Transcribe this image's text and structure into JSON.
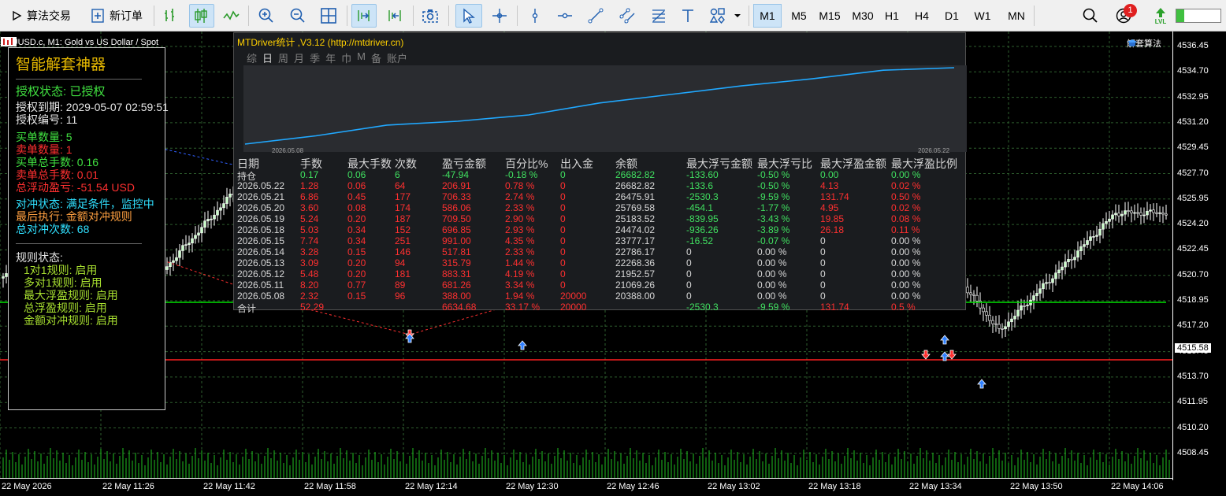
{
  "toolbar": {
    "algo_trading_label": "算法交易",
    "new_order_label": "新订单",
    "timeframes": [
      "M1",
      "M5",
      "M15",
      "M30",
      "H1",
      "H4",
      "D1",
      "W1",
      "MN"
    ],
    "active_timeframe": "M1",
    "notification_count": "1",
    "lvl_label": "LVL"
  },
  "chart": {
    "symbol_label": "XAUUSD.c, M1:  Gold vs US Dollar / Spot",
    "algo_name": "解套算法",
    "current_price": "4515.58",
    "price_ticks": [
      "4536.45",
      "4534.70",
      "4532.95",
      "4531.20",
      "4529.45",
      "4527.70",
      "4525.95",
      "4524.20",
      "4522.45",
      "4520.70",
      "4518.95",
      "4517.20",
      "4515.45",
      "4513.70",
      "4511.95",
      "4510.20",
      "4508.45"
    ],
    "time_ticks": [
      "22 May 2026",
      "22 May 11:26",
      "22 May 11:42",
      "22 May 11:58",
      "22 May 12:14",
      "22 May 12:30",
      "22 May 12:46",
      "22 May 13:02",
      "22 May 13:18",
      "22 May 13:34",
      "22 May 13:50",
      "22 May 14:06"
    ],
    "colors": {
      "background": "#000000",
      "bull": "#c8ffc8",
      "bear": "#ffffff",
      "green_level": "#00e000",
      "red_level": "#ff2020",
      "grid": "#2e5e2e"
    }
  },
  "info_panel": {
    "title": "智能解套神器",
    "auth_status": "授权状态: 已授权",
    "auth_expiry": "授权到期: 2029-05-07 02:59:51",
    "auth_number": "授权编号: 11",
    "buy_count": "买单数量: 5",
    "sell_count": "卖单数量: 1",
    "buy_lots": "买单总手数: 0.16",
    "sell_lots": "卖单总手数: 0.01",
    "floating_pl": "总浮动盈亏: -51.54 USD",
    "hedge_status": "对冲状态: 满足条件，监控中",
    "last_exec": "最后执行: 金额对冲规则",
    "hedge_count": "总对冲次数: 68",
    "rules_title": "规则状态:",
    "rules": [
      "1对1规则: 启用",
      "多对1规则: 启用",
      "最大浮盈规则: 启用",
      "总浮盈规则: 启用",
      "金额对冲规则: 启用"
    ]
  },
  "stats_panel": {
    "title": "MTDriver统计 ,V3.12 (http://mtdriver.cn)",
    "tabs": [
      "综",
      "日",
      "周",
      "月",
      "季",
      "年",
      "巾",
      "M",
      "备",
      "账户"
    ],
    "active_tab": "日",
    "equity_start_date": "2026.05.08",
    "equity_end_date": "2026.05.22",
    "columns": [
      "日期",
      "手数",
      "最大手数",
      "次数",
      "盈亏金额",
      "百分比%",
      "出入金",
      "余额",
      "最大浮亏金额",
      "最大浮亏比",
      "最大浮盈金额",
      "最大浮盈比例"
    ],
    "rows": [
      [
        "持仓",
        "0.17",
        "0.06",
        "6",
        "-47.94",
        "-0.18 %",
        "0",
        "26682.82",
        "-133.60",
        "-0.50 %",
        "0.00",
        "0.00 %"
      ],
      [
        "2026.05.22",
        "1.28",
        "0.06",
        "64",
        "206.91",
        "0.78 %",
        "0",
        "26682.82",
        "-133.6",
        "-0.50 %",
        "4.13",
        "0.02 %"
      ],
      [
        "2026.05.21",
        "6.86",
        "0.45",
        "177",
        "706.33",
        "2.74 %",
        "0",
        "26475.91",
        "-2530.3",
        "-9.59 %",
        "131.74",
        "0.50 %"
      ],
      [
        "2026.05.20",
        "3.60",
        "0.08",
        "174",
        "586.06",
        "2.33 %",
        "0",
        "25769.58",
        "-454.1",
        "-1.77 %",
        "4.95",
        "0.02 %"
      ],
      [
        "2026.05.19",
        "5.24",
        "0.20",
        "187",
        "709.50",
        "2.90 %",
        "0",
        "25183.52",
        "-839.95",
        "-3.43 %",
        "19.85",
        "0.08 %"
      ],
      [
        "2026.05.18",
        "5.03",
        "0.34",
        "152",
        "696.85",
        "2.93 %",
        "0",
        "24474.02",
        "-936.26",
        "-3.89 %",
        "26.18",
        "0.11 %"
      ],
      [
        "2026.05.15",
        "7.74",
        "0.34",
        "251",
        "991.00",
        "4.35 %",
        "0",
        "23777.17",
        "-16.52",
        "-0.07 %",
        "0",
        "0.00 %"
      ],
      [
        "2026.05.14",
        "3.28",
        "0.15",
        "146",
        "517.81",
        "2.33 %",
        "0",
        "22786.17",
        "0",
        "0.00 %",
        "0",
        "0.00 %"
      ],
      [
        "2026.05.13",
        "3.09",
        "0.20",
        "94",
        "315.79",
        "1.44 %",
        "0",
        "22268.36",
        "0",
        "0.00 %",
        "0",
        "0.00 %"
      ],
      [
        "2026.05.12",
        "5.48",
        "0.20",
        "181",
        "883.31",
        "4.19 %",
        "0",
        "21952.57",
        "0",
        "0.00 %",
        "0",
        "0.00 %"
      ],
      [
        "2026.05.11",
        "8.20",
        "0.77",
        "89",
        "681.26",
        "3.34 %",
        "0",
        "21069.26",
        "0",
        "0.00 %",
        "0",
        "0.00 %"
      ],
      [
        "2026.05.08",
        "2.32",
        "0.15",
        "96",
        "388.00",
        "1.94 %",
        "20000",
        "20388.00",
        "0",
        "0.00 %",
        "0",
        "0.00 %"
      ],
      [
        "合计",
        "52.29",
        "",
        "",
        "6634.68",
        "33.17 %",
        "20000",
        "",
        "-2530.3",
        "-9.59 %",
        "131.74",
        "0.5 %"
      ]
    ]
  }
}
